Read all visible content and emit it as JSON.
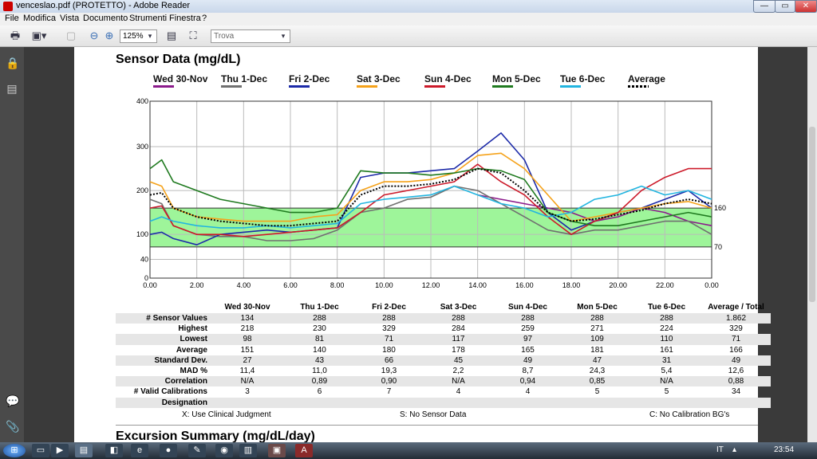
{
  "window": {
    "title": "venceslao.pdf (PROTETTO) - Adobe Reader",
    "minimize": "—",
    "maximize": "▭",
    "close": "✕"
  },
  "menu": [
    "File",
    "Modifica",
    "Vista",
    "Documento",
    "Strumenti",
    "Finestra",
    "?"
  ],
  "toolbar": {
    "zoom": "125%",
    "find_placeholder": "Trova"
  },
  "page": {
    "section_title": "Sensor Data (mg/dL)",
    "next_title": "Excursion Summary (mg/dL/day)"
  },
  "legend": [
    {
      "label": "Wed 30-Nov",
      "color": "#8b1a8b"
    },
    {
      "label": "Thu 1-Dec",
      "color": "#707070"
    },
    {
      "label": "Fri 2-Dec",
      "color": "#1c2aa8"
    },
    {
      "label": "Sat 3-Dec",
      "color": "#f5a21a"
    },
    {
      "label": "Sun 4-Dec",
      "color": "#cc1a2a"
    },
    {
      "label": "Mon 5-Dec",
      "color": "#1f7a1f"
    },
    {
      "label": "Tue 6-Dec",
      "color": "#22b5e0"
    },
    {
      "label": "Average",
      "color": "#000000"
    }
  ],
  "chart_data": {
    "type": "line",
    "x_ticks": [
      "0.00",
      "2.00",
      "4.00",
      "6.00",
      "8.00",
      "10.00",
      "12.00",
      "14.00",
      "16.00",
      "18.00",
      "20.00",
      "22.00",
      "0.00"
    ],
    "y_ticks": [
      "0",
      "40",
      "100",
      "200",
      "300",
      "400"
    ],
    "ylim": [
      0,
      400
    ],
    "xlim": [
      0,
      24
    ],
    "target_range": {
      "low": 70,
      "high": 160,
      "color": "#9ef59a"
    },
    "right_labels": [
      "160",
      "70"
    ],
    "x": [
      0,
      0.5,
      1,
      2,
      3,
      4,
      5,
      6,
      7,
      8,
      9,
      10,
      11,
      12,
      13,
      14,
      15,
      16,
      17,
      18,
      19,
      20,
      21,
      22,
      23,
      24
    ],
    "series": [
      {
        "name": "Wed 30-Nov",
        "color": "#8b1a8b",
        "values": [
          null,
          null,
          null,
          null,
          null,
          null,
          null,
          null,
          null,
          null,
          null,
          null,
          null,
          null,
          null,
          190,
          180,
          170,
          160,
          150,
          130,
          140,
          160,
          150,
          130,
          120
        ]
      },
      {
        "name": "Thu 1-Dec",
        "color": "#707070",
        "values": [
          180,
          170,
          120,
          100,
          95,
          95,
          85,
          85,
          90,
          110,
          150,
          160,
          180,
          185,
          210,
          200,
          170,
          140,
          110,
          100,
          110,
          110,
          120,
          130,
          130,
          100
        ]
      },
      {
        "name": "Fri 2-Dec",
        "color": "#1c2aa8",
        "values": [
          100,
          105,
          90,
          75,
          100,
          105,
          110,
          105,
          110,
          115,
          230,
          240,
          240,
          245,
          250,
          290,
          330,
          270,
          150,
          110,
          130,
          150,
          160,
          180,
          200,
          160
        ]
      },
      {
        "name": "Sat 3-Dec",
        "color": "#f5a21a",
        "values": [
          220,
          210,
          160,
          140,
          135,
          130,
          130,
          130,
          140,
          145,
          200,
          220,
          220,
          225,
          240,
          280,
          285,
          250,
          190,
          130,
          140,
          150,
          160,
          170,
          175,
          160
        ]
      },
      {
        "name": "Sun 4-Dec",
        "color": "#cc1a2a",
        "values": [
          160,
          165,
          120,
          100,
          100,
          95,
          100,
          105,
          110,
          115,
          150,
          190,
          200,
          210,
          220,
          260,
          220,
          190,
          140,
          100,
          130,
          150,
          200,
          230,
          250,
          250
        ]
      },
      {
        "name": "Mon 5-Dec",
        "color": "#1f7a1f",
        "values": [
          250,
          270,
          220,
          200,
          180,
          170,
          160,
          150,
          150,
          160,
          245,
          240,
          240,
          235,
          240,
          250,
          245,
          225,
          150,
          130,
          120,
          120,
          130,
          140,
          150,
          140
        ]
      },
      {
        "name": "Tue 6-Dec",
        "color": "#22b5e0",
        "values": [
          130,
          140,
          130,
          120,
          115,
          115,
          120,
          115,
          120,
          125,
          170,
          180,
          185,
          190,
          210,
          190,
          170,
          160,
          140,
          150,
          180,
          190,
          210,
          190,
          200,
          180
        ]
      },
      {
        "name": "Average",
        "color": "#000000",
        "dashed": true,
        "values": [
          190,
          195,
          160,
          140,
          130,
          125,
          120,
          120,
          125,
          130,
          190,
          210,
          210,
          215,
          225,
          250,
          240,
          200,
          150,
          130,
          135,
          145,
          155,
          170,
          180,
          170
        ]
      }
    ]
  },
  "table": {
    "headers": [
      "",
      "Wed 30-Nov",
      "Thu 1-Dec",
      "Fri 2-Dec",
      "Sat 3-Dec",
      "Sun 4-Dec",
      "Mon 5-Dec",
      "Tue 6-Dec",
      "Average / Total"
    ],
    "rows": [
      [
        "# Sensor Values",
        "134",
        "288",
        "288",
        "288",
        "288",
        "288",
        "288",
        "1.862"
      ],
      [
        "Highest",
        "218",
        "230",
        "329",
        "284",
        "259",
        "271",
        "224",
        "329"
      ],
      [
        "Lowest",
        "98",
        "81",
        "71",
        "117",
        "97",
        "109",
        "110",
        "71"
      ],
      [
        "Average",
        "151",
        "140",
        "180",
        "178",
        "165",
        "181",
        "161",
        "166"
      ],
      [
        "Standard Dev.",
        "27",
        "43",
        "66",
        "45",
        "49",
        "47",
        "31",
        "49"
      ],
      [
        "MAD %",
        "11,4",
        "11,0",
        "19,3",
        "2,2",
        "8,7",
        "24,3",
        "5,4",
        "12,6"
      ],
      [
        "Correlation",
        "N/A",
        "0,89",
        "0,90",
        "N/A",
        "0,94",
        "0,85",
        "N/A",
        "0,88"
      ],
      [
        "# Valid Calibrations",
        "3",
        "6",
        "7",
        "4",
        "4",
        "5",
        "5",
        "34"
      ],
      [
        "Designation",
        "",
        "",
        "",
        "",
        "",
        "",
        "",
        ""
      ]
    ]
  },
  "footnotes": {
    "a": "X: Use Clinical Judgment",
    "b": "S: No Sensor Data",
    "c": "C: No Calibration BG's"
  },
  "taskbar": {
    "lang": "IT",
    "time": "23:54"
  }
}
